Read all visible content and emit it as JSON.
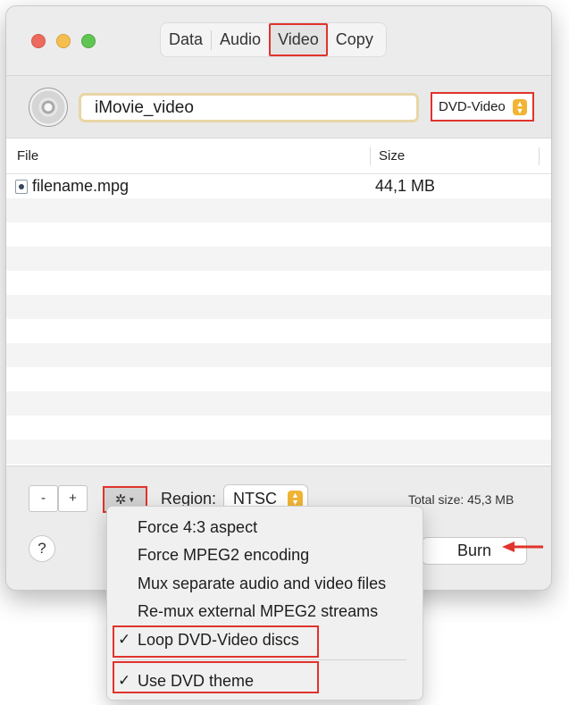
{
  "window": {
    "tabs": [
      {
        "label": "Data",
        "active": false
      },
      {
        "label": "Audio",
        "active": false
      },
      {
        "label": "Video",
        "active": true
      },
      {
        "label": "Copy",
        "active": false
      }
    ]
  },
  "disc": {
    "name": "iMovie_video",
    "type": "DVD-Video"
  },
  "table": {
    "headers": {
      "file": "File",
      "size": "Size"
    },
    "rows": [
      {
        "name": "filename.mpg",
        "size": "44,1 MB"
      }
    ]
  },
  "bottombar": {
    "minus_label": "-",
    "plus_label": "+",
    "gear_glyph": "✲",
    "region_label": "Region:",
    "region_value": "NTSC",
    "total_size": "Total size: 45,3 MB"
  },
  "footer": {
    "help_label": "?",
    "burn_label": "Burn"
  },
  "menu": {
    "items": [
      {
        "label": "Force 4:3 aspect",
        "checked": false
      },
      {
        "label": "Force MPEG2 encoding",
        "checked": false
      },
      {
        "label": "Mux separate audio and video files",
        "checked": false
      },
      {
        "label": "Re-mux external MPEG2 streams",
        "checked": false
      },
      {
        "label": "Loop DVD-Video discs",
        "checked": true
      },
      {
        "label": "Use DVD theme",
        "checked": true
      }
    ],
    "check_glyph": "✓"
  },
  "colors": {
    "highlight": "#e0342c",
    "accent_stepper": "#f1b434"
  }
}
